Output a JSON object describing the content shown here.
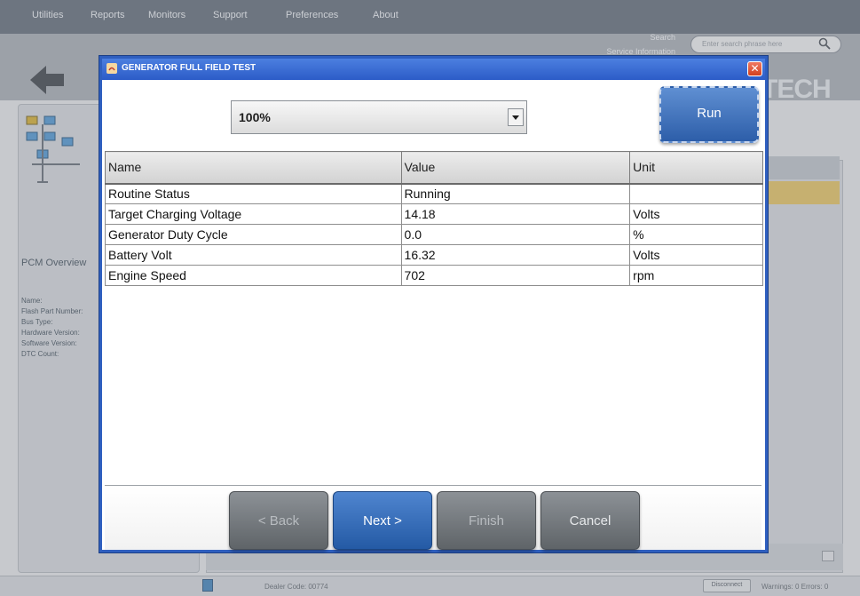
{
  "menu": {
    "items": [
      "Utilities",
      "Reports",
      "Monitors",
      "Support",
      "Preferences",
      "About"
    ]
  },
  "header": {
    "search_label": "Search",
    "service_info_label": "Service Information",
    "search_placeholder": "Enter search phrase here",
    "logo_text": "TECH"
  },
  "left_panel": {
    "overview_title": "PCM Overview",
    "fields": [
      "Name:",
      "Flash Part Number:",
      "Bus Type:",
      "Hardware Version:",
      "Software Version:",
      "DTC Count:"
    ]
  },
  "status_bar": {
    "dealer_code": "Dealer Code: 00774",
    "disconnect_label": "Disconnect",
    "warnings_errors": "Warnings: 0 Errors: 0"
  },
  "dialog": {
    "title": "GENERATOR FULL FIELD TEST",
    "close_symbol": "✕",
    "percent_selected": "100%",
    "run_label": "Run",
    "table": {
      "headers": [
        "Name",
        "Value",
        "Unit"
      ],
      "rows": [
        [
          "Routine Status",
          "Running",
          ""
        ],
        [
          "Target Charging Voltage",
          "14.18",
          "Volts"
        ],
        [
          "Generator Duty Cycle",
          "0.0",
          "%"
        ],
        [
          "Battery Volt",
          "16.32",
          "Volts"
        ],
        [
          "Engine Speed",
          "702",
          "rpm"
        ]
      ]
    },
    "buttons": {
      "back": "< Back",
      "next": "Next >",
      "finish": "Finish",
      "cancel": "Cancel"
    }
  },
  "colors": {
    "dialog_border": "#2f5fbf",
    "run_button": "#3c6db5",
    "next_button": "#2f66b6",
    "disabled_button": "#73787d",
    "close_button": "#d9472a"
  }
}
